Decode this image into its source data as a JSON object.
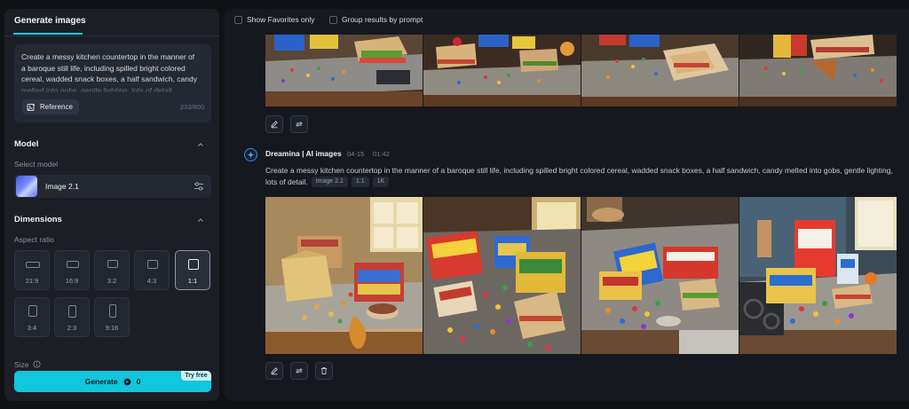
{
  "sidebar": {
    "tab_label": "Generate images",
    "prompt_text": "Create a messy kitchen countertop in the manner of a baroque still life, including spilled bright colored cereal, wadded snack boxes, a half sandwich, candy melted into gobs, gentle lighting, lots of detail.",
    "reference_label": "Reference",
    "char_count": "233/800",
    "model_section": "Model",
    "select_model_label": "Select model",
    "model_name": "Image 2.1",
    "dimensions_section": "Dimensions",
    "aspect_ratio_label": "Aspect ratio",
    "ratios": [
      {
        "label": "21:9",
        "selected": false
      },
      {
        "label": "16:9",
        "selected": false
      },
      {
        "label": "3:2",
        "selected": false
      },
      {
        "label": "4:3",
        "selected": false
      },
      {
        "label": "1:1",
        "selected": true
      },
      {
        "label": "3:4",
        "selected": false
      },
      {
        "label": "2:3",
        "selected": false
      },
      {
        "label": "9:16",
        "selected": false
      }
    ],
    "size_label": "Size",
    "generate_label": "Generate",
    "generate_cost": "0",
    "try_free_label": "Try free"
  },
  "main": {
    "filters": {
      "favorites_label": "Show Favorites only",
      "group_label": "Group results by prompt"
    },
    "generation": {
      "title": "Dreamina | AI images",
      "date": "04-15",
      "time": "01:42",
      "prompt_line1": "Create a messy kitchen countertop in the manner of a baroque still life, including spilled bright colored cereal, wadded snack boxes, a half sandwich, candy melted into gobs, gentle lighting,",
      "prompt_line2": "lots of detail.",
      "chips": [
        "Image 2.1",
        "1:1",
        "1K"
      ]
    }
  },
  "colors": {
    "accent": "#11c6dd",
    "panel_bg": "#1b1e25",
    "main_bg": "#15181e",
    "page_bg": "#0f1115",
    "avatar_ring": "#2e8ff0"
  }
}
